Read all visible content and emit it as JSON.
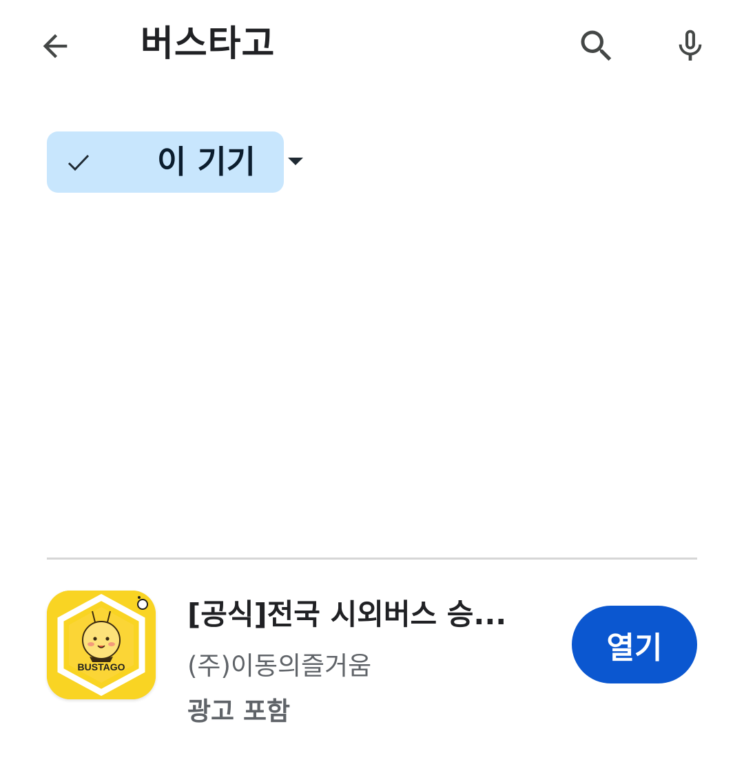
{
  "header": {
    "back_icon": "arrow-back-icon",
    "query": "버스타고",
    "search_icon": "search-icon",
    "mic_icon": "mic-icon"
  },
  "filter_chip": {
    "label": "이 기기",
    "check_icon": "check-icon",
    "dropdown_icon": "dropdown-caret-icon",
    "selected": true,
    "background": "#c8e6fd"
  },
  "result": {
    "app_name": "[공식]전국 시외버스 승...",
    "developer": "(주)이동의즐거움",
    "ads_label": "광고 포함",
    "open_label": "열기",
    "icon_text": "BUSTAGO",
    "icon_background": "#f9d423",
    "button_color": "#0b57d0"
  }
}
